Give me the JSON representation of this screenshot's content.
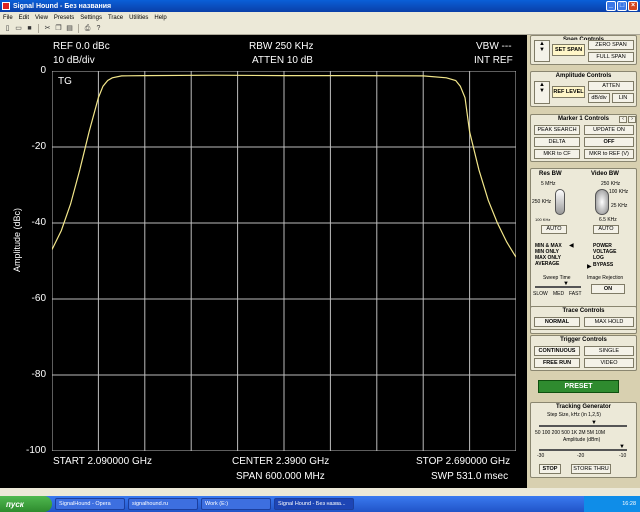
{
  "window": {
    "title": "Signal Hound - Без названия",
    "menu": [
      "File",
      "Edit",
      "View",
      "Presets",
      "Settings",
      "Trace",
      "Utilities",
      "Help"
    ]
  },
  "display": {
    "ref": "REF 0.0 dBc",
    "scale": "10 dB/div",
    "rbw": "RBW 250 KHz",
    "atten": "ATTEN 10 dB",
    "vbw": "VBW ---",
    "intref": "INT REF",
    "tg": "TG",
    "start": "START 2.090000 GHz",
    "center": "CENTER 2.3900 GHz",
    "span": "SPAN 600.000 MHz",
    "stop": "STOP 2.690000 GHz",
    "swp": "SWP 531.0 msec",
    "trace_color": "#f2e68a",
    "grid_color": "#bdbdbd"
  },
  "chart_data": {
    "type": "line",
    "ylabel": "Amplitude (dBc)",
    "xlim": [
      2.09,
      2.69
    ],
    "ylim": [
      -100,
      0
    ],
    "yticks": [
      "0",
      "-20",
      "-40",
      "-60",
      "-80",
      "-100"
    ],
    "grid": true,
    "series": [
      {
        "x": [
          2.09,
          2.102,
          2.114,
          2.126,
          2.138,
          2.15,
          2.156,
          2.162,
          2.168,
          2.18,
          2.21,
          2.3,
          2.39,
          2.48,
          2.57,
          2.6,
          2.612,
          2.618,
          2.624,
          2.63,
          2.642,
          2.654,
          2.666,
          2.678,
          2.69
        ],
        "y": [
          -47,
          -42,
          -35,
          -26,
          -16,
          -7,
          -4,
          -2.5,
          -1.8,
          -1.3,
          -1.2,
          -1.1,
          -1.2,
          -1.2,
          -1.3,
          -1.8,
          -2.5,
          -4,
          -7,
          -16,
          -26,
          -34,
          -40,
          -45,
          -49
        ]
      }
    ]
  },
  "panel": {
    "span_controls": {
      "title": "Span Controls",
      "set_span": "SET SPAN",
      "zero_span": "ZERO SPAN",
      "full_span": "FULL SPAN"
    },
    "amplitude": {
      "title": "Amplitude Controls",
      "ref_level": "REF LEVEL",
      "atten": "ATTEN",
      "dbdiv": "dB/div",
      "lin": "LIN"
    },
    "marker": {
      "title": "Marker 1 Controls",
      "peak_search": "PEAK SEARCH",
      "update_on": "UPDATE ON",
      "delta": "DELTA",
      "off": "OFF",
      "mkr_cf": "MKR to CF",
      "mkr_ref": "MKR to REF (V)"
    },
    "bw": {
      "res_title": "Res BW",
      "video_title": "Video BW",
      "res_top": "5 MHz",
      "res_mid": "250 KHz",
      "res_bot": "100 KHz",
      "vid_top": "250 KHz",
      "vid_mid1": "100 KHz",
      "vid_mid2": "25 KHz",
      "vid_bot": "6.5 KHz",
      "auto1": "AUTO",
      "auto2": "AUTO",
      "det": [
        "MIN & MAX",
        "MIN ONLY",
        "MAX ONLY",
        "AVERAGE"
      ],
      "vid": [
        "POWER",
        "VOLTAGE",
        "LOG",
        "BYPASS"
      ],
      "sweep_time": "Sweep Time",
      "slow": "SLOW",
      "med": "MED",
      "fast": "FAST",
      "image_rejection": "Image Rejection",
      "on": "ON"
    },
    "trace": {
      "title": "Trace Controls",
      "normal": "NORMAL",
      "max_hold": "MAX HOLD"
    },
    "trigger": {
      "title": "Trigger Controls",
      "continuous": "CONTINUOUS",
      "single": "SINGLE",
      "free_run": "FREE RUN",
      "video": "VIDEO"
    },
    "preset": "PRESET",
    "tracking": {
      "title": "Tracking Generator",
      "step_label": "Step Size, kHz (in 1,2,5)",
      "step_ticks": "50 100 200 500 1K 2M 5M 10M",
      "amp_label": "Amplitude (dBm)",
      "amp_ticks_l": "-30",
      "amp_ticks_m": "-20",
      "amp_ticks_r": "-10",
      "stop": "STOP",
      "store_thru": "STORE THRU"
    }
  },
  "taskbar": {
    "start": "пуск",
    "tasks": [
      "SignalHound - Opera",
      "signalhound.ru",
      "Work (E:)",
      "Signal Hound - Без назва..."
    ],
    "clock": "16:28"
  }
}
